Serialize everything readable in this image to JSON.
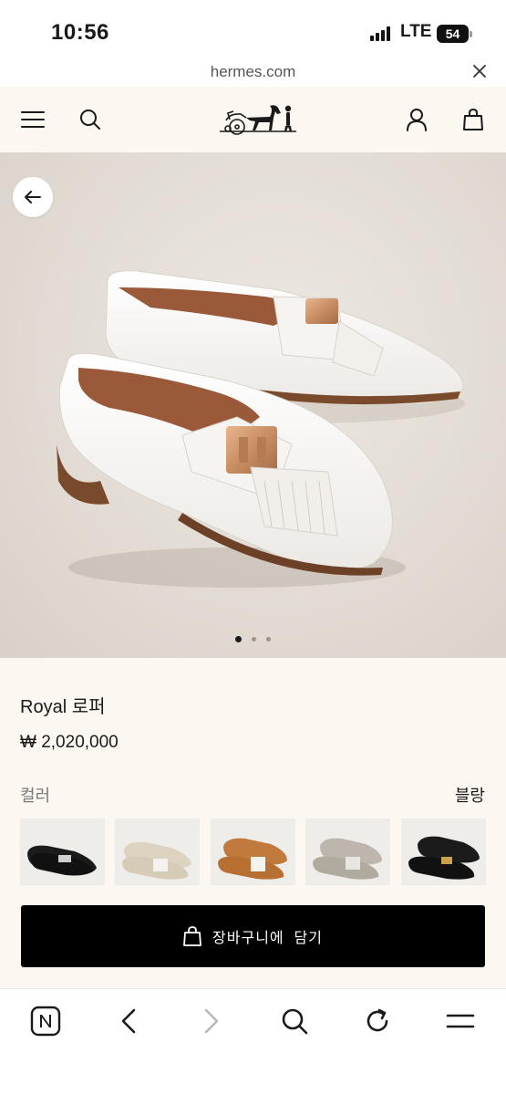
{
  "status_bar": {
    "time": "10:56",
    "network": "LTE",
    "battery": "54"
  },
  "url_bar": {
    "domain": "hermes.com",
    "close_icon": "close-icon"
  },
  "header": {
    "menu_icon": "hamburger-menu-icon",
    "search_icon": "search-icon",
    "logo_icon": "hermes-carriage-logo",
    "account_icon": "user-icon",
    "cart_icon": "shopping-bag-icon"
  },
  "gallery": {
    "back_icon": "arrow-left-icon",
    "image": "white-leather-loafers-with-gold-h-buckle-and-fringe",
    "dots": [
      true,
      false,
      false
    ]
  },
  "product": {
    "name": "Royal 로퍼",
    "price": "₩ 2,020,000",
    "color_label": "컬러",
    "color_value": "블랑"
  },
  "swatches": [
    {
      "name": "black-loafer"
    },
    {
      "name": "beige-loafer"
    },
    {
      "name": "tan-loafer"
    },
    {
      "name": "grey-loafer"
    },
    {
      "name": "black-gold-loafer"
    }
  ],
  "cart_button": {
    "label": "장바구니에  담기",
    "icon": "shopping-bag-icon"
  },
  "browser_nav": {
    "items": [
      "naver-home-icon",
      "back-chevron-icon",
      "forward-chevron-icon",
      "search-icon",
      "refresh-icon",
      "menu-icon"
    ]
  },
  "colors": {
    "accent": "#000000",
    "background": "#fcf7f1",
    "hero_bg": "#e4ded6",
    "buckle": "#c88d62"
  }
}
